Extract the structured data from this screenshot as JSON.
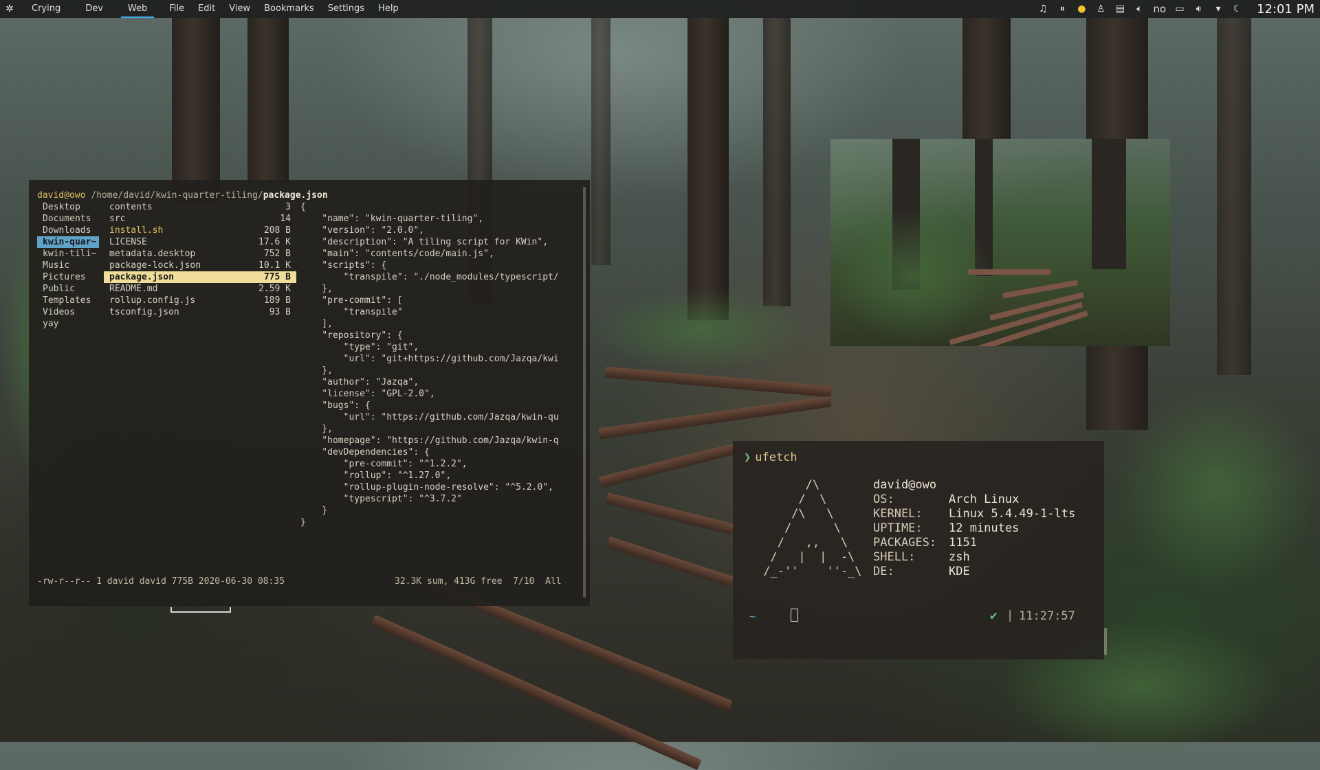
{
  "panel": {
    "launcher_icon": "kde-icon",
    "desktops": [
      {
        "label": "Crying",
        "active": false
      },
      {
        "label": "Dev",
        "active": false
      },
      {
        "label": "Web",
        "active": true
      }
    ],
    "menu": [
      "File",
      "Edit",
      "View",
      "Bookmarks",
      "Settings",
      "Help"
    ],
    "tray_text": "no",
    "clock": "12:01 PM",
    "accent": "#3daee9"
  },
  "file_manager": {
    "path": {
      "user": "david@owo",
      "dir": " /home/david/kwin-quarter-tiling/",
      "file": "package.json"
    },
    "parent_dirs": [
      {
        "name": "Desktop",
        "selected": false
      },
      {
        "name": "Documents",
        "selected": false
      },
      {
        "name": "Downloads",
        "selected": false
      },
      {
        "name": "kwin-quar~",
        "selected": true
      },
      {
        "name": "kwin-tili~",
        "selected": false
      },
      {
        "name": "Music",
        "selected": false
      },
      {
        "name": "Pictures",
        "selected": false
      },
      {
        "name": "Public",
        "selected": false
      },
      {
        "name": "Templates",
        "selected": false
      },
      {
        "name": "Videos",
        "selected": false
      },
      {
        "name": "yay",
        "selected": false
      }
    ],
    "files": [
      {
        "name": "contents",
        "size": "3",
        "selected": false,
        "exec": false
      },
      {
        "name": "src",
        "size": "14",
        "selected": false,
        "exec": false
      },
      {
        "name": "install.sh",
        "size": "208 B",
        "selected": false,
        "exec": true
      },
      {
        "name": "LICENSE",
        "size": "17.6 K",
        "selected": false,
        "exec": false
      },
      {
        "name": "metadata.desktop",
        "size": "752 B",
        "selected": false,
        "exec": false
      },
      {
        "name": "package-lock.json",
        "size": "10.1 K",
        "selected": false,
        "exec": false
      },
      {
        "name": "package.json",
        "size": "775 B",
        "selected": true,
        "exec": false
      },
      {
        "name": "README.md",
        "size": "2.59 K",
        "selected": false,
        "exec": false
      },
      {
        "name": "rollup.config.js",
        "size": "189 B",
        "selected": false,
        "exec": false
      },
      {
        "name": "tsconfig.json",
        "size": "93 B",
        "selected": false,
        "exec": false
      }
    ],
    "preview_lines": [
      "{",
      "    \"name\": \"kwin-quarter-tiling\",",
      "    \"version\": \"2.0.0\",",
      "    \"description\": \"A tiling script for KWin\",",
      "    \"main\": \"contents/code/main.js\",",
      "    \"scripts\": {",
      "        \"transpile\": \"./node_modules/typescript/",
      "    },",
      "    \"pre-commit\": [",
      "        \"transpile\"",
      "    ],",
      "    \"repository\": {",
      "        \"type\": \"git\",",
      "        \"url\": \"git+https://github.com/Jazqa/kwi",
      "    },",
      "    \"author\": \"Jazqa\",",
      "    \"license\": \"GPL-2.0\",",
      "    \"bugs\": {",
      "        \"url\": \"https://github.com/Jazqa/kwin-qu",
      "    },",
      "    \"homepage\": \"https://github.com/Jazqa/kwin-q",
      "    \"devDependencies\": {",
      "        \"pre-commit\": \"^1.2.2\",",
      "        \"rollup\": \"^1.27.0\",",
      "        \"rollup-plugin-node-resolve\": \"^5.2.0\",",
      "        \"typescript\": \"^3.7.2\"",
      "    }",
      "}"
    ],
    "status_left": "-rw-r--r-- 1 david david 775B 2020-06-30 08:35",
    "status_right": "32.3K sum, 413G free  7/10  All"
  },
  "ufetch": {
    "command": "ufetch",
    "logo": "       /\\\n      /  \\\n     /\\   \\\n    /      \\\n   /   ,,   \\\n  /   |  |  -\\\n /_-''    ''-_\\",
    "user": "david@owo",
    "info": [
      {
        "key": "OS:",
        "value": "Arch Linux"
      },
      {
        "key": "KERNEL:",
        "value": "Linux 5.4.49-1-lts"
      },
      {
        "key": "UPTIME:",
        "value": "12 minutes"
      },
      {
        "key": "PACKAGES:",
        "value": "1151"
      },
      {
        "key": "SHELL:",
        "value": "zsh"
      },
      {
        "key": "DE:",
        "value": "KDE"
      }
    ],
    "prompt_dir": "~",
    "check": "✔",
    "separator": "|",
    "time": "11:27:57"
  }
}
